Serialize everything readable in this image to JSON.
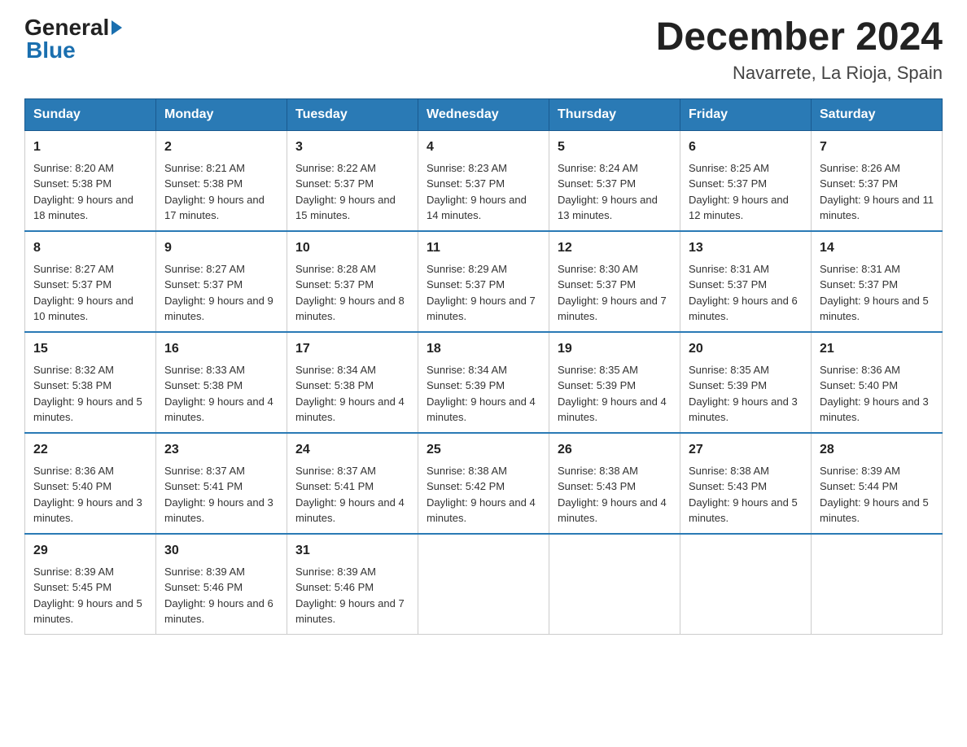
{
  "logo": {
    "general": "General",
    "arrow": "►",
    "blue": "Blue"
  },
  "title": "December 2024",
  "location": "Navarrete, La Rioja, Spain",
  "days_of_week": [
    "Sunday",
    "Monday",
    "Tuesday",
    "Wednesday",
    "Thursday",
    "Friday",
    "Saturday"
  ],
  "weeks": [
    [
      {
        "day": "1",
        "sunrise": "8:20 AM",
        "sunset": "5:38 PM",
        "daylight": "9 hours and 18 minutes."
      },
      {
        "day": "2",
        "sunrise": "8:21 AM",
        "sunset": "5:38 PM",
        "daylight": "9 hours and 17 minutes."
      },
      {
        "day": "3",
        "sunrise": "8:22 AM",
        "sunset": "5:37 PM",
        "daylight": "9 hours and 15 minutes."
      },
      {
        "day": "4",
        "sunrise": "8:23 AM",
        "sunset": "5:37 PM",
        "daylight": "9 hours and 14 minutes."
      },
      {
        "day": "5",
        "sunrise": "8:24 AM",
        "sunset": "5:37 PM",
        "daylight": "9 hours and 13 minutes."
      },
      {
        "day": "6",
        "sunrise": "8:25 AM",
        "sunset": "5:37 PM",
        "daylight": "9 hours and 12 minutes."
      },
      {
        "day": "7",
        "sunrise": "8:26 AM",
        "sunset": "5:37 PM",
        "daylight": "9 hours and 11 minutes."
      }
    ],
    [
      {
        "day": "8",
        "sunrise": "8:27 AM",
        "sunset": "5:37 PM",
        "daylight": "9 hours and 10 minutes."
      },
      {
        "day": "9",
        "sunrise": "8:27 AM",
        "sunset": "5:37 PM",
        "daylight": "9 hours and 9 minutes."
      },
      {
        "day": "10",
        "sunrise": "8:28 AM",
        "sunset": "5:37 PM",
        "daylight": "9 hours and 8 minutes."
      },
      {
        "day": "11",
        "sunrise": "8:29 AM",
        "sunset": "5:37 PM",
        "daylight": "9 hours and 7 minutes."
      },
      {
        "day": "12",
        "sunrise": "8:30 AM",
        "sunset": "5:37 PM",
        "daylight": "9 hours and 7 minutes."
      },
      {
        "day": "13",
        "sunrise": "8:31 AM",
        "sunset": "5:37 PM",
        "daylight": "9 hours and 6 minutes."
      },
      {
        "day": "14",
        "sunrise": "8:31 AM",
        "sunset": "5:37 PM",
        "daylight": "9 hours and 5 minutes."
      }
    ],
    [
      {
        "day": "15",
        "sunrise": "8:32 AM",
        "sunset": "5:38 PM",
        "daylight": "9 hours and 5 minutes."
      },
      {
        "day": "16",
        "sunrise": "8:33 AM",
        "sunset": "5:38 PM",
        "daylight": "9 hours and 4 minutes."
      },
      {
        "day": "17",
        "sunrise": "8:34 AM",
        "sunset": "5:38 PM",
        "daylight": "9 hours and 4 minutes."
      },
      {
        "day": "18",
        "sunrise": "8:34 AM",
        "sunset": "5:39 PM",
        "daylight": "9 hours and 4 minutes."
      },
      {
        "day": "19",
        "sunrise": "8:35 AM",
        "sunset": "5:39 PM",
        "daylight": "9 hours and 4 minutes."
      },
      {
        "day": "20",
        "sunrise": "8:35 AM",
        "sunset": "5:39 PM",
        "daylight": "9 hours and 3 minutes."
      },
      {
        "day": "21",
        "sunrise": "8:36 AM",
        "sunset": "5:40 PM",
        "daylight": "9 hours and 3 minutes."
      }
    ],
    [
      {
        "day": "22",
        "sunrise": "8:36 AM",
        "sunset": "5:40 PM",
        "daylight": "9 hours and 3 minutes."
      },
      {
        "day": "23",
        "sunrise": "8:37 AM",
        "sunset": "5:41 PM",
        "daylight": "9 hours and 3 minutes."
      },
      {
        "day": "24",
        "sunrise": "8:37 AM",
        "sunset": "5:41 PM",
        "daylight": "9 hours and 4 minutes."
      },
      {
        "day": "25",
        "sunrise": "8:38 AM",
        "sunset": "5:42 PM",
        "daylight": "9 hours and 4 minutes."
      },
      {
        "day": "26",
        "sunrise": "8:38 AM",
        "sunset": "5:43 PM",
        "daylight": "9 hours and 4 minutes."
      },
      {
        "day": "27",
        "sunrise": "8:38 AM",
        "sunset": "5:43 PM",
        "daylight": "9 hours and 5 minutes."
      },
      {
        "day": "28",
        "sunrise": "8:39 AM",
        "sunset": "5:44 PM",
        "daylight": "9 hours and 5 minutes."
      }
    ],
    [
      {
        "day": "29",
        "sunrise": "8:39 AM",
        "sunset": "5:45 PM",
        "daylight": "9 hours and 5 minutes."
      },
      {
        "day": "30",
        "sunrise": "8:39 AM",
        "sunset": "5:46 PM",
        "daylight": "9 hours and 6 minutes."
      },
      {
        "day": "31",
        "sunrise": "8:39 AM",
        "sunset": "5:46 PM",
        "daylight": "9 hours and 7 minutes."
      },
      null,
      null,
      null,
      null
    ]
  ]
}
